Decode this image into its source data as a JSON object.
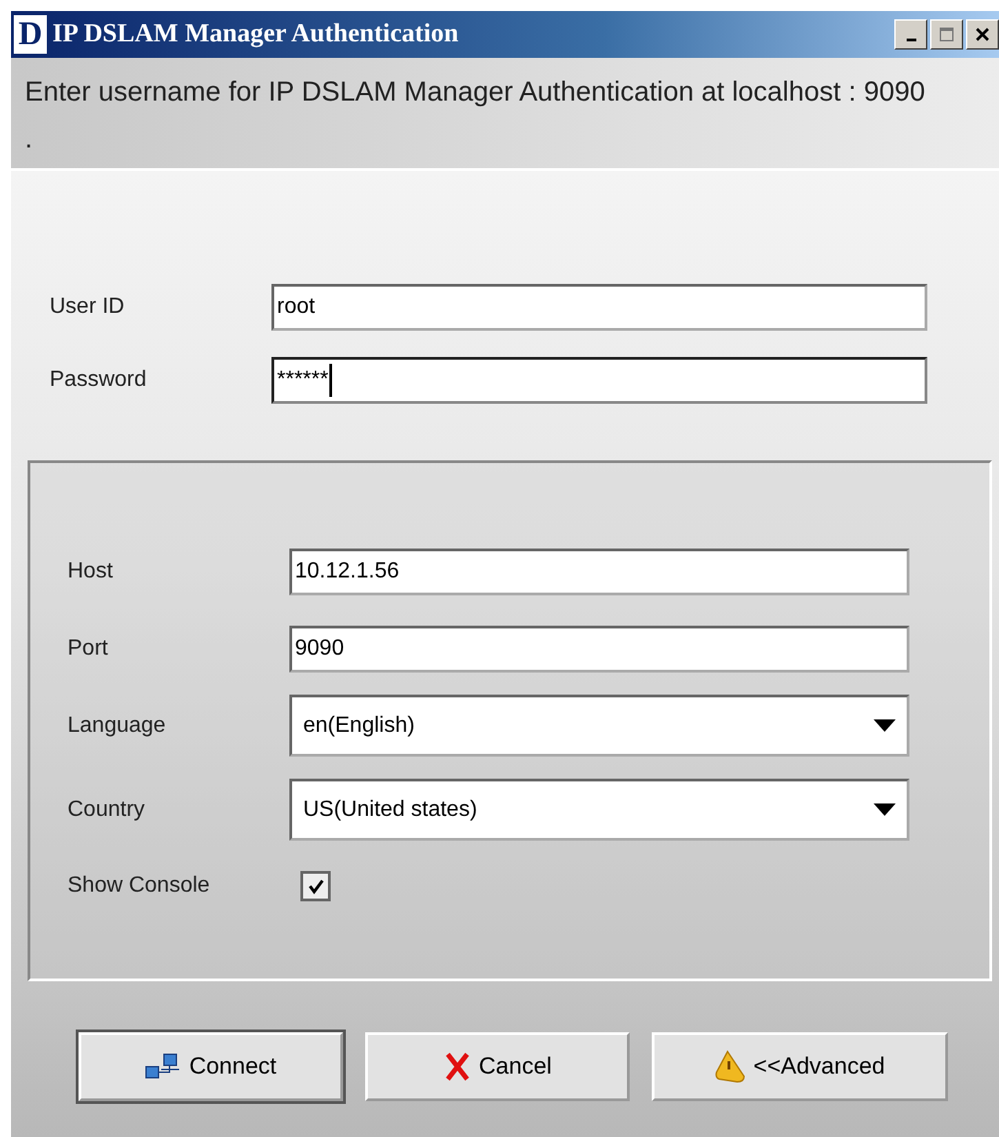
{
  "window": {
    "title": "IP DSLAM Manager Authentication",
    "logo": "D"
  },
  "message": "Enter username for IP DSLAM Manager Authentication at localhost : 9090 .",
  "credentials": [
    {
      "label": "User ID",
      "value": "root",
      "focused": false
    },
    {
      "label": "Password",
      "value": "******",
      "focused": true
    }
  ],
  "advanced": [
    {
      "kind": "text",
      "label": "Host",
      "value": "10.12.1.56"
    },
    {
      "kind": "text",
      "label": "Port",
      "value": "9090"
    },
    {
      "kind": "select",
      "label": "Language",
      "value": "en(English)"
    },
    {
      "kind": "select",
      "label": "Country",
      "value": "US(United states)"
    },
    {
      "kind": "checkbox",
      "label": "Show Console",
      "checked": true
    }
  ],
  "buttons": [
    {
      "kind": "connect",
      "label": "Connect",
      "default": true
    },
    {
      "kind": "cancel",
      "label": "Cancel",
      "default": false
    },
    {
      "kind": "advanced",
      "label": "<<Advanced",
      "default": false
    }
  ]
}
